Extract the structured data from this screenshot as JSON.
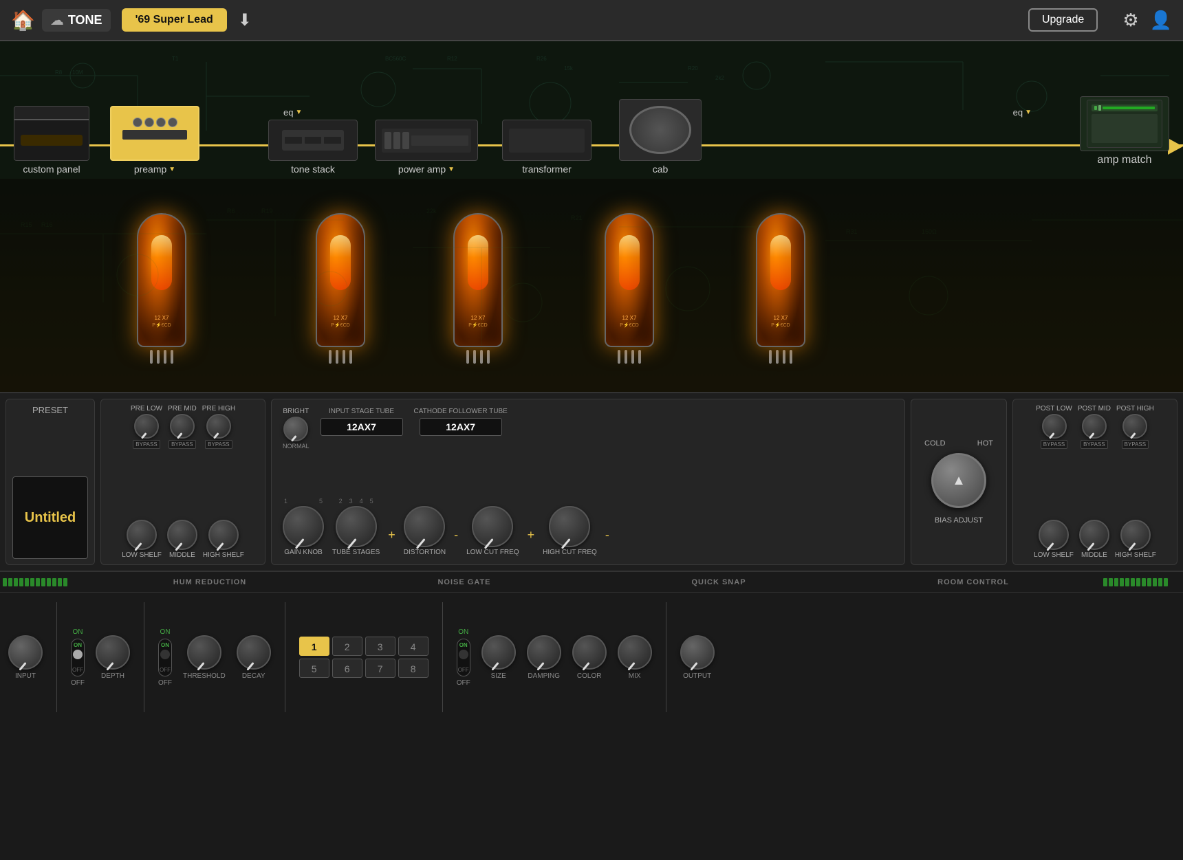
{
  "topbar": {
    "home_label": "🏠",
    "cloud_icon": "☁",
    "tone_label": "TONE",
    "preset_name": "'69 Super Lead",
    "download_icon": "⬇",
    "upgrade_label": "Upgrade",
    "settings_icon": "⚙",
    "user_icon": "👤",
    "amp_match_label": "amp match",
    "eq_label": "eq"
  },
  "signal_chain": {
    "items": [
      {
        "id": "custom-panel",
        "label": "custom panel",
        "has_arrow": false
      },
      {
        "id": "preamp",
        "label": "preamp",
        "has_arrow": true
      },
      {
        "id": "tonestack",
        "label": "tone stack",
        "has_arrow": false
      },
      {
        "id": "poweramp",
        "label": "power amp",
        "has_arrow": true
      },
      {
        "id": "transformer",
        "label": "transformer",
        "has_arrow": false
      },
      {
        "id": "cab",
        "label": "cab",
        "has_arrow": false
      }
    ]
  },
  "preset": {
    "label": "PRESET",
    "name": "Untitled"
  },
  "pre_eq": {
    "knobs": [
      {
        "id": "pre-low",
        "label": "PRE LOW",
        "badge": "BYPASS"
      },
      {
        "id": "pre-mid",
        "label": "PRE MID",
        "badge": "BYPASS"
      },
      {
        "id": "pre-high",
        "label": "PRE HIGH",
        "badge": "BYPASS"
      }
    ],
    "bottom_knobs": [
      {
        "id": "low-shelf",
        "label": "LOW SHELF"
      },
      {
        "id": "middle",
        "label": "MIDDLE"
      },
      {
        "id": "high-shelf-pre",
        "label": "HIGH SHELF"
      }
    ]
  },
  "preamp_main": {
    "bright_label": "BRIGHT",
    "normal_label": "NORMAL",
    "input_tube_label": "INPUT STAGE TUBE",
    "input_tube_value": "12AX7",
    "cathode_tube_label": "CATHODE FOLLOWER TUBE",
    "cathode_tube_value": "12AX7",
    "gain_knob_label": "GAIN KNOB",
    "tube_stages_label": "TUBE STAGES",
    "distortion_label": "DISTORTION",
    "low_cut_label": "LOW CUT FREQ",
    "high_cut_label": "HIGH CUT FREQ",
    "scale_1_5": [
      "1",
      "2",
      "3",
      "4",
      "5"
    ],
    "scale_pm": [
      "-",
      "5",
      "+"
    ]
  },
  "bias": {
    "cold_label": "COLD",
    "hot_label": "HOT",
    "adjust_label": "BIAS ADJUST"
  },
  "post_eq": {
    "knobs": [
      {
        "id": "post-low",
        "label": "POST LOW",
        "badge": "BYPASS"
      },
      {
        "id": "post-mid",
        "label": "POST MID",
        "badge": "BYPASS"
      },
      {
        "id": "post-high",
        "label": "POST HIGH",
        "badge": "BYPASS"
      }
    ],
    "bottom_knobs": [
      {
        "id": "post-low-shelf",
        "label": "LOW SHELF"
      },
      {
        "id": "post-middle",
        "label": "MIDDLE"
      },
      {
        "id": "post-high-shelf",
        "label": "HIGH SHELF"
      }
    ]
  },
  "bottom": {
    "hum_label": "HUM REDUCTION",
    "noise_label": "NOISE GATE",
    "snap_label": "QUICK SNAP",
    "room_label": "ROOM CONTROL",
    "input_label": "INPUT",
    "on_label": "ON",
    "off_label": "OFF",
    "depth_label": "DEPTH",
    "threshold_label": "THRESHOLD",
    "decay_label": "DECAY",
    "output_label": "OUTPUT",
    "size_label": "SIZE",
    "damping_label": "DAMPING",
    "color_label": "COLOR",
    "mix_label": "MIX",
    "snap_buttons": [
      "1",
      "2",
      "3",
      "4",
      "5",
      "6",
      "7",
      "8"
    ],
    "snap_active": 0
  }
}
